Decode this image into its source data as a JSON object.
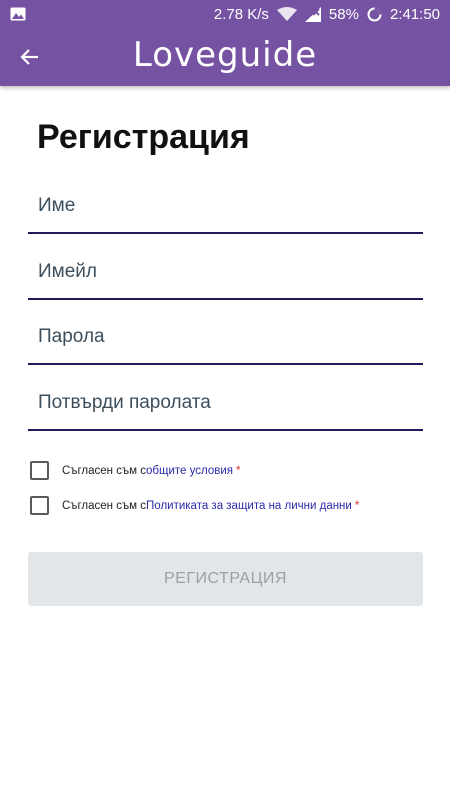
{
  "status_bar": {
    "network_speed": "2.78 K/s",
    "battery": "58%",
    "time": "2:41:50",
    "icons": [
      "image-icon",
      "wifi-icon",
      "signal-icon",
      "battery-icon"
    ]
  },
  "app_bar": {
    "logo": "Loveguide",
    "back_icon": "arrow-left-icon",
    "background": "#7653a2"
  },
  "page": {
    "title": "Регистрация"
  },
  "form": {
    "name_placeholder": "Име",
    "email_placeholder": "Имейл",
    "password_placeholder": "Парола",
    "confirm_password_placeholder": "Потвърди паролата",
    "terms": {
      "prefix": "Съгласен съм с ",
      "link": "общите условия",
      "required_mark": "*",
      "checked": false
    },
    "privacy": {
      "prefix": "Съгласен съм с ",
      "link": "Политиката за защита на лични данни",
      "required_mark": "*",
      "checked": false
    },
    "submit_label": "РЕГИСТРАЦИЯ",
    "submit_enabled": false
  }
}
